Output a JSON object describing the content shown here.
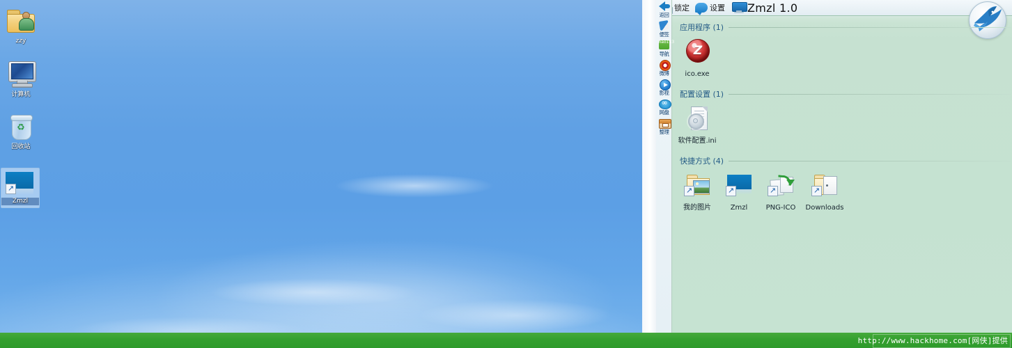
{
  "desktop": {
    "icons": [
      {
        "label": "zzy",
        "icon": "user-folder-icon"
      },
      {
        "label": "计算机",
        "icon": "computer-icon"
      },
      {
        "label": "回收站",
        "icon": "recycle-bin-icon"
      },
      {
        "label": "Zmzl",
        "icon": "zmzl-shortcut-icon",
        "selected": true
      }
    ]
  },
  "panel": {
    "titlebar": {
      "lock_label": "锁定",
      "settings_label": "设置",
      "app_title": "Zmzl 1.0",
      "lock_icon": "lock-icon",
      "settings_icon": "speech-bubble-icon",
      "app_icon": "monitor-icon"
    },
    "sidebar": {
      "items": [
        {
          "label": "返回",
          "icon": "back-arrow-icon"
        },
        {
          "label": "便签",
          "icon": "sticky-note-pen-icon"
        },
        {
          "label": "导航",
          "icon": "hao123-nav-icon",
          "badge": "hao123"
        },
        {
          "label": "微博",
          "icon": "weibo-eye-icon"
        },
        {
          "label": "影视",
          "icon": "video-play-icon"
        },
        {
          "label": "网盘",
          "icon": "cloud-disk-icon"
        },
        {
          "label": "整理",
          "icon": "organize-box-icon"
        }
      ]
    },
    "sections": [
      {
        "title": "应用程序 (1)",
        "items": [
          {
            "label": "ico.exe",
            "icon": "red-sphere-exe-icon",
            "shortcut": false
          }
        ]
      },
      {
        "title": "配置设置 (1)",
        "items": [
          {
            "label": "软件配置.ini",
            "icon": "ini-gear-document-icon",
            "shortcut": false
          }
        ]
      },
      {
        "title": "快捷方式 (4)",
        "items": [
          {
            "label": "我的图片",
            "icon": "pictures-folder-icon",
            "shortcut": true
          },
          {
            "label": "Zmzl",
            "icon": "zmzl-rect-icon",
            "shortcut": true
          },
          {
            "label": "PNG-ICO",
            "icon": "png-to-ico-convert-icon",
            "shortcut": true
          },
          {
            "label": "Downloads",
            "icon": "open-folder-icon",
            "shortcut": true
          }
        ]
      }
    ],
    "logo": {
      "icon": "blue-swallow-bird-logo"
    }
  },
  "statusbar": {
    "watermark": "http://www.hackhome.com[网侠]提供"
  },
  "colors": {
    "panel_bg": "#c5e2d1",
    "titlebar_bg": "#eaf2f6",
    "section_title": "#245b86",
    "bottom_bar": "#34a02f",
    "desktop_sky": "#5fa0e4",
    "accent_blue": "#0d7fc4"
  }
}
